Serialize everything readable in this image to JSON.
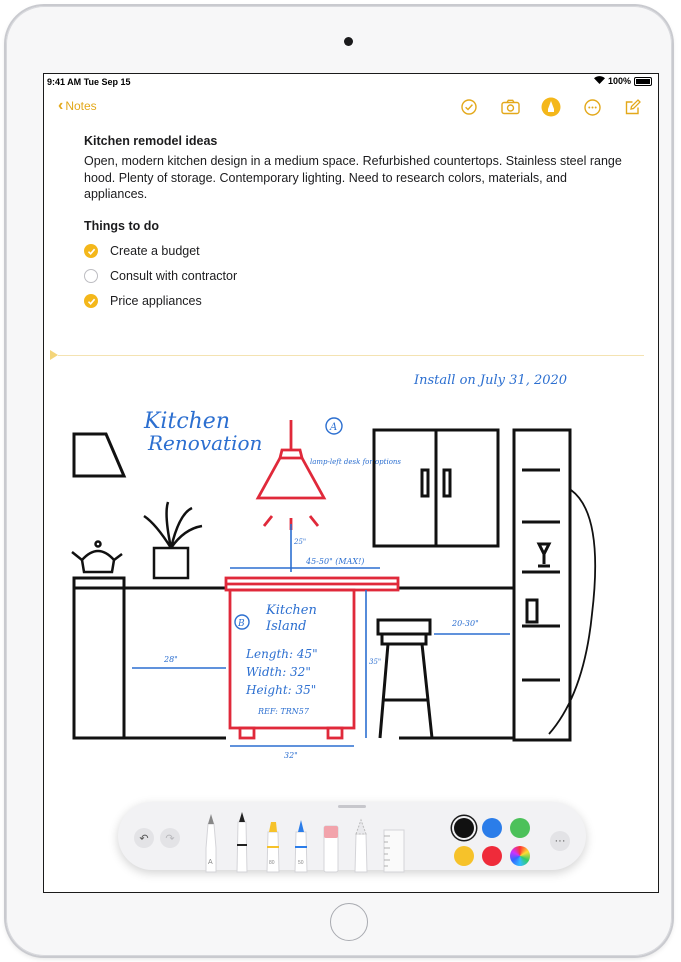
{
  "status_bar": {
    "time": "9:41 AM",
    "date": "Tue Sep 15",
    "battery": "100%"
  },
  "nav": {
    "back_label": "Notes",
    "icons": [
      "checklist-icon",
      "camera-icon",
      "markup-pen-icon",
      "more-icon",
      "compose-icon"
    ],
    "accent": "#e3a81a"
  },
  "note": {
    "title": "Kitchen remodel ideas",
    "body": "Open, modern kitchen design in a medium space. Refurbished countertops. Stainless steel range hood. Plenty of storage. Contemporary lighting. Need to research colors, materials, and appliances.",
    "todo_heading": "Things to do",
    "todos": [
      {
        "label": "Create a budget",
        "checked": true
      },
      {
        "label": "Consult with contractor",
        "checked": false
      },
      {
        "label": "Price appliances",
        "checked": true
      }
    ]
  },
  "sketch": {
    "annotations": {
      "kitchen_renovation_1": "Kitchen",
      "kitchen_renovation_2": "Renovation",
      "install": "Install on July 31, 2020",
      "circle_a": "A",
      "lamp_note": "lamp-left desk for options",
      "drop": "25\"",
      "width_top": "45-50\" (MAX!)",
      "island_b": "B",
      "island_title_1": "Kitchen",
      "island_title_2": "Island",
      "length": "Length: 45\"",
      "width": "Width: 32\"",
      "height": "Height: 35\"",
      "ref": "REF: TRN57",
      "left_dim": "28\"",
      "right_dim": "20-30\"",
      "bottom_dim": "32\"",
      "side_dim": "35\""
    }
  },
  "toolbar": {
    "undo": "undo-icon",
    "redo": "redo-icon",
    "tools": [
      "pencil-tool",
      "pen-tool",
      "highlighter-tool",
      "marker-tool",
      "eraser-tool",
      "lasso-tool",
      "ruler-tool"
    ],
    "tool_labels": {
      "pencil": "A",
      "highlighter": "80",
      "marker": "50"
    },
    "colors": [
      {
        "name": "black",
        "hex": "#111111",
        "selected": true
      },
      {
        "name": "blue",
        "hex": "#2b7de9",
        "selected": false
      },
      {
        "name": "green",
        "hex": "#4cc15a",
        "selected": false
      },
      {
        "name": "yellow",
        "hex": "#f6c22a",
        "selected": false
      },
      {
        "name": "red",
        "hex": "#ef2b3a",
        "selected": false
      },
      {
        "name": "multicolor",
        "hex": "conic",
        "selected": false
      }
    ]
  }
}
